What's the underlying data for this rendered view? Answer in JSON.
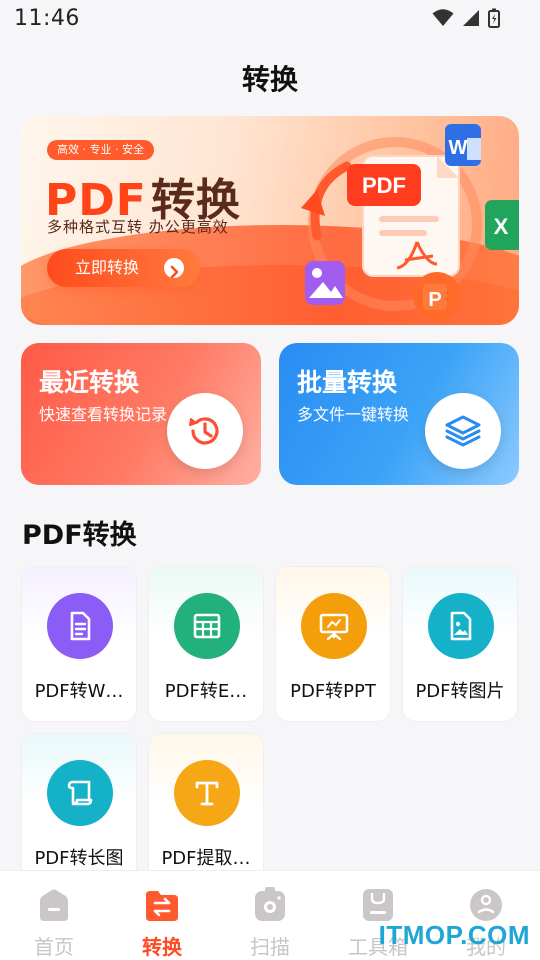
{
  "status_bar": {
    "time": "11:46"
  },
  "page": {
    "title": "转换"
  },
  "banner": {
    "tag": "高效 · 专业 · 安全",
    "headline_a": "PDF",
    "headline_b": "转换",
    "subtitle": "多种格式互转  办公更高效",
    "button_label": "立即转换",
    "art_doc_label": "PDF",
    "icon_word": "W",
    "icon_excel": "X",
    "icon_ppt": "P"
  },
  "cards": {
    "recent": {
      "title": "最近转换",
      "subtitle": "快速查看转换记录",
      "icon": "history-icon"
    },
    "batch": {
      "title": "批量转换",
      "subtitle": "多文件一键转换",
      "icon": "layers-icon"
    }
  },
  "section": {
    "title": "PDF转换"
  },
  "tools": [
    {
      "label": "PDF转W…",
      "icon": "document-icon",
      "color": "#8b5cf6"
    },
    {
      "label": "PDF转E…",
      "icon": "table-icon",
      "color": "#22b07d"
    },
    {
      "label": "PDF转PPT",
      "icon": "presentation-icon",
      "color": "#f59e0b"
    },
    {
      "label": "PDF转图片",
      "icon": "image-icon",
      "color": "#14b1c8"
    },
    {
      "label": "PDF转长图",
      "icon": "scroll-icon",
      "color": "#14b1c8"
    },
    {
      "label": "PDF提取…",
      "icon": "text-icon",
      "color": "#f5a716"
    }
  ],
  "nav": {
    "items": [
      {
        "label": "首页",
        "icon": "home-icon",
        "active": false
      },
      {
        "label": "转换",
        "icon": "convert-icon",
        "active": true
      },
      {
        "label": "扫描",
        "icon": "camera-icon",
        "active": false
      },
      {
        "label": "工具箱",
        "icon": "toolbox-icon",
        "active": false
      },
      {
        "label": "我的",
        "icon": "profile-icon",
        "active": false
      }
    ]
  },
  "watermark": "ITMOP.COM",
  "colors": {
    "accent": "#ff4a24",
    "background": "#f6f5f8"
  }
}
